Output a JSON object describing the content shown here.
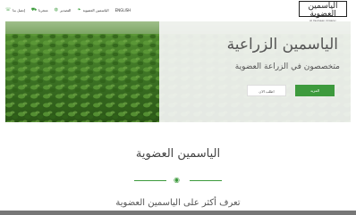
{
  "header": {
    "logo_ar": "الياسمين العضوية",
    "logo_en": "Al Yasmeen Organic",
    "nav": [
      {
        "label": "ENGLISH",
        "icon": ""
      },
      {
        "label": "الياسمين العضوية",
        "icon": "leaf-icon"
      },
      {
        "label": "التصدير",
        "icon": "globe-icon"
      },
      {
        "label": "متجرنا",
        "icon": "cart-icon"
      },
      {
        "label": "إتصل بنا",
        "icon": "phone-icon"
      }
    ]
  },
  "hero": {
    "title": "الياسمين الزراعية",
    "subtitle": "متخصصون في الزراعة العضوية",
    "primary_button": "المزيد",
    "secondary_button": "اطلب الان"
  },
  "section": {
    "title": "الياسمين العضوية",
    "about_link": "تعرف أكثر على الياسمين العضوية"
  },
  "colors": {
    "accent": "#3d9a3d"
  }
}
